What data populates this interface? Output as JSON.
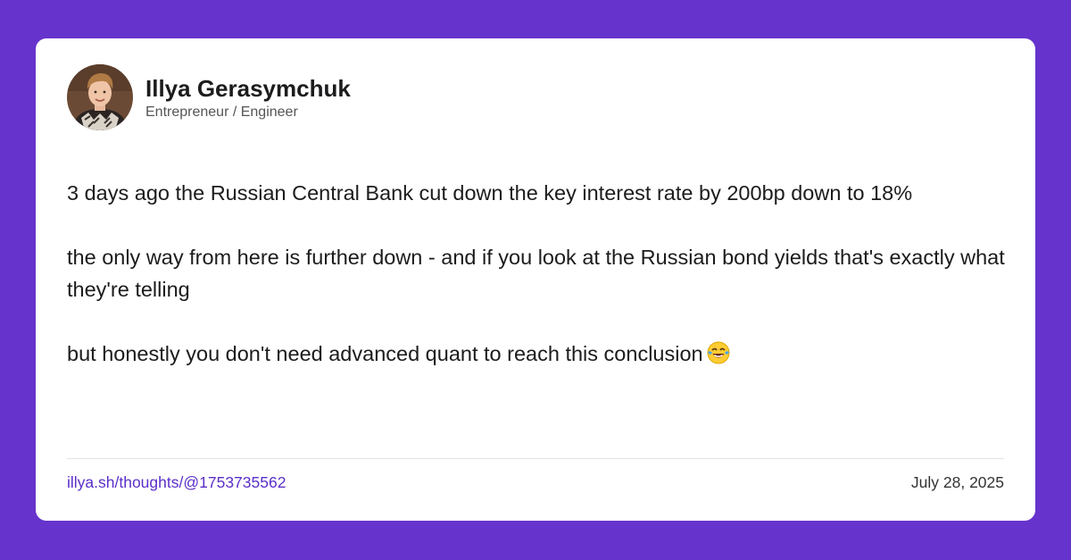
{
  "author": {
    "name": "Illya Gerasymchuk",
    "role": "Entrepreneur / Engineer",
    "avatar_icon": "person-photo-avatar"
  },
  "post": {
    "paragraphs": [
      "3 days ago the Russian Central Bank cut down the key interest rate by 200bp down to 18%",
      "the only way from here is further down - and if you look at the Russian bond yields that's exactly what they're telling",
      "but honestly you don't need advanced quant to reach this conclusion"
    ],
    "emoji": "face-with-tears-of-joy-icon"
  },
  "footer": {
    "permalink": "illya.sh/thoughts/@1753735562",
    "date": "July 28, 2025"
  },
  "colors": {
    "background": "#6633cc",
    "card": "#ffffff",
    "link": "#5b2fc9",
    "text": "#1c1c1e"
  }
}
